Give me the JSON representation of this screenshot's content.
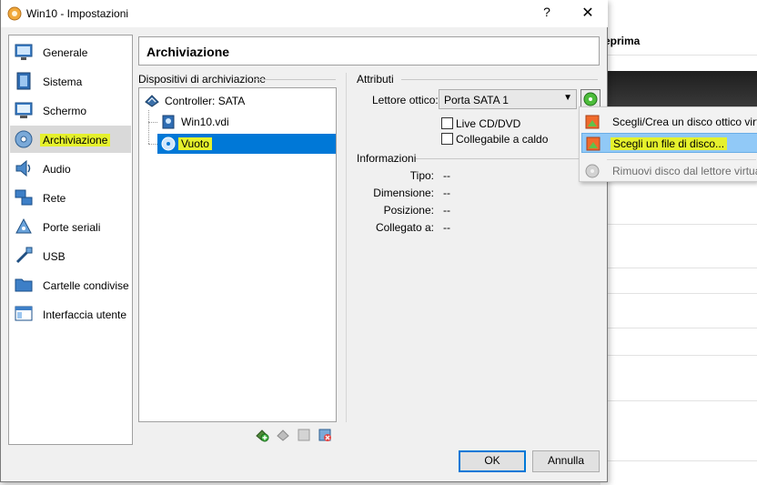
{
  "window": {
    "title": "Win10 - Impostazioni",
    "help_label": "?",
    "close_label": "✕"
  },
  "background_app": {
    "header_fragment": "eprima"
  },
  "categories": [
    {
      "label": "Generale",
      "icon": "monitor-icon"
    },
    {
      "label": "Sistema",
      "icon": "chip-icon"
    },
    {
      "label": "Schermo",
      "icon": "display-icon"
    },
    {
      "label": "Archiviazione",
      "icon": "storage-icon",
      "selected": true
    },
    {
      "label": "Audio",
      "icon": "speaker-icon"
    },
    {
      "label": "Rete",
      "icon": "network-icon"
    },
    {
      "label": "Porte seriali",
      "icon": "serial-port-icon"
    },
    {
      "label": "USB",
      "icon": "usb-icon"
    },
    {
      "label": "Cartelle condivise",
      "icon": "folder-icon"
    },
    {
      "label": "Interfaccia utente",
      "icon": "ui-icon"
    }
  ],
  "section": {
    "title": "Archiviazione"
  },
  "devices": {
    "label": "Dispositivi di archiviazione",
    "controller": "Controller: SATA",
    "items": [
      {
        "label": "Win10.vdi",
        "icon": "hard-disk-icon"
      },
      {
        "label": "Vuoto",
        "icon": "optical-disc-icon",
        "selected": true
      }
    ]
  },
  "attributes": {
    "label": "Attributi",
    "optical_drive_label": "Lettore ottico:",
    "optical_drive_value": "Porta SATA 1",
    "live_cd_label": "Live CD/DVD",
    "hotplug_label": "Collegabile a caldo"
  },
  "information": {
    "label": "Informazioni",
    "rows": [
      {
        "key": "Tipo:",
        "value": "--"
      },
      {
        "key": "Dimensione:",
        "value": "--"
      },
      {
        "key": "Posizione:",
        "value": "--"
      },
      {
        "key": "Collegato a:",
        "value": "--"
      }
    ]
  },
  "buttons": {
    "ok": "OK",
    "cancel": "Annulla"
  },
  "popup_menu": {
    "items": [
      {
        "label": "Scegli/Crea un disco ottico virt"
      },
      {
        "label": "Scegli un file di disco..."
      },
      {
        "label": "Rimuovi disco dal lettore virtua"
      }
    ]
  },
  "colors": {
    "selection": "#0078d7",
    "highlight_marker": "#e5f12c",
    "menu_hover": "#91c9f7"
  }
}
